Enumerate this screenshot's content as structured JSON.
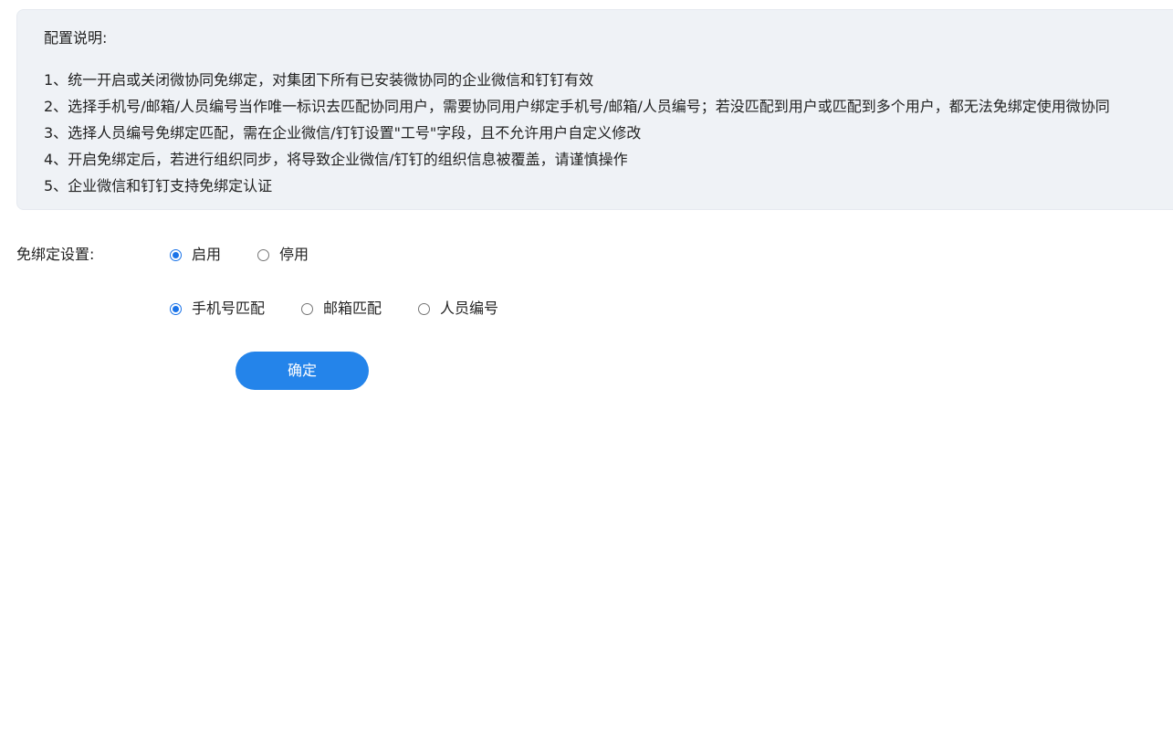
{
  "notice": {
    "title": "配置说明:",
    "items": [
      "1、统一开启或关闭微协同免绑定，对集团下所有已安装微协同的企业微信和钉钉有效",
      "2、选择手机号/邮箱/人员编号当作唯一标识去匹配协同用户，需要协同用户绑定手机号/邮箱/人员编号；若没匹配到用户或匹配到多个用户，都无法免绑定使用微协同",
      "3、选择人员编号免绑定匹配，需在企业微信/钉钉设置\"工号\"字段，且不允许用户自定义修改",
      "4、开启免绑定后，若进行组织同步，将导致企业微信/钉钉的组织信息被覆盖，请谨慎操作",
      "5、企业微信和钉钉支持免绑定认证"
    ]
  },
  "form": {
    "label": "免绑定设置:",
    "enable_options": [
      {
        "label": "启用",
        "checked": true
      },
      {
        "label": "停用",
        "checked": false
      }
    ],
    "match_options": [
      {
        "label": "手机号匹配",
        "checked": true
      },
      {
        "label": "邮箱匹配",
        "checked": false
      },
      {
        "label": "人员编号",
        "checked": false
      }
    ],
    "confirm_label": "确定"
  },
  "colors": {
    "accent": "#1a73e8",
    "button": "#2484ea",
    "notice_bg": "#eff2f6"
  }
}
